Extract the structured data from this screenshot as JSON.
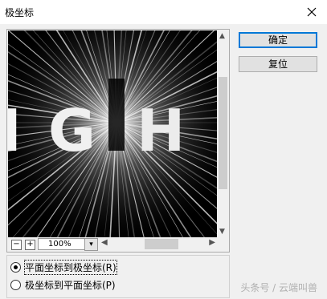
{
  "window": {
    "title": "极坐标"
  },
  "preview": {
    "zoom": "100%",
    "text_fragments": [
      "I",
      "G",
      "H"
    ]
  },
  "buttons": {
    "ok": "确定",
    "reset": "复位"
  },
  "options": [
    {
      "label": "平面坐标到极坐标(R)",
      "selected": true
    },
    {
      "label": "极坐标到平面坐标(P)",
      "selected": false
    }
  ],
  "watermark": "头条号 / 云端叫兽"
}
